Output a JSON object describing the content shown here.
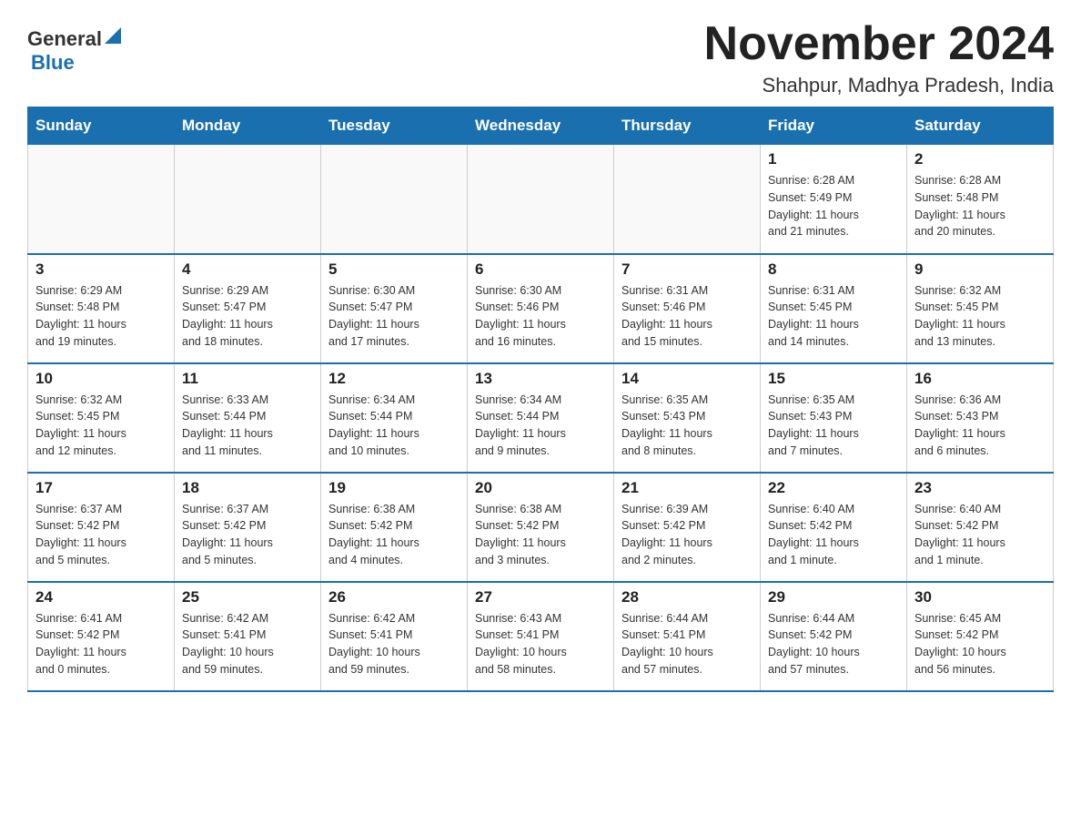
{
  "header": {
    "logo_general": "General",
    "logo_blue": "Blue",
    "month_title": "November 2024",
    "location": "Shahpur, Madhya Pradesh, India"
  },
  "days_of_week": [
    "Sunday",
    "Monday",
    "Tuesday",
    "Wednesday",
    "Thursday",
    "Friday",
    "Saturday"
  ],
  "weeks": [
    [
      {
        "day": "",
        "info": ""
      },
      {
        "day": "",
        "info": ""
      },
      {
        "day": "",
        "info": ""
      },
      {
        "day": "",
        "info": ""
      },
      {
        "day": "",
        "info": ""
      },
      {
        "day": "1",
        "info": "Sunrise: 6:28 AM\nSunset: 5:49 PM\nDaylight: 11 hours\nand 21 minutes."
      },
      {
        "day": "2",
        "info": "Sunrise: 6:28 AM\nSunset: 5:48 PM\nDaylight: 11 hours\nand 20 minutes."
      }
    ],
    [
      {
        "day": "3",
        "info": "Sunrise: 6:29 AM\nSunset: 5:48 PM\nDaylight: 11 hours\nand 19 minutes."
      },
      {
        "day": "4",
        "info": "Sunrise: 6:29 AM\nSunset: 5:47 PM\nDaylight: 11 hours\nand 18 minutes."
      },
      {
        "day": "5",
        "info": "Sunrise: 6:30 AM\nSunset: 5:47 PM\nDaylight: 11 hours\nand 17 minutes."
      },
      {
        "day": "6",
        "info": "Sunrise: 6:30 AM\nSunset: 5:46 PM\nDaylight: 11 hours\nand 16 minutes."
      },
      {
        "day": "7",
        "info": "Sunrise: 6:31 AM\nSunset: 5:46 PM\nDaylight: 11 hours\nand 15 minutes."
      },
      {
        "day": "8",
        "info": "Sunrise: 6:31 AM\nSunset: 5:45 PM\nDaylight: 11 hours\nand 14 minutes."
      },
      {
        "day": "9",
        "info": "Sunrise: 6:32 AM\nSunset: 5:45 PM\nDaylight: 11 hours\nand 13 minutes."
      }
    ],
    [
      {
        "day": "10",
        "info": "Sunrise: 6:32 AM\nSunset: 5:45 PM\nDaylight: 11 hours\nand 12 minutes."
      },
      {
        "day": "11",
        "info": "Sunrise: 6:33 AM\nSunset: 5:44 PM\nDaylight: 11 hours\nand 11 minutes."
      },
      {
        "day": "12",
        "info": "Sunrise: 6:34 AM\nSunset: 5:44 PM\nDaylight: 11 hours\nand 10 minutes."
      },
      {
        "day": "13",
        "info": "Sunrise: 6:34 AM\nSunset: 5:44 PM\nDaylight: 11 hours\nand 9 minutes."
      },
      {
        "day": "14",
        "info": "Sunrise: 6:35 AM\nSunset: 5:43 PM\nDaylight: 11 hours\nand 8 minutes."
      },
      {
        "day": "15",
        "info": "Sunrise: 6:35 AM\nSunset: 5:43 PM\nDaylight: 11 hours\nand 7 minutes."
      },
      {
        "day": "16",
        "info": "Sunrise: 6:36 AM\nSunset: 5:43 PM\nDaylight: 11 hours\nand 6 minutes."
      }
    ],
    [
      {
        "day": "17",
        "info": "Sunrise: 6:37 AM\nSunset: 5:42 PM\nDaylight: 11 hours\nand 5 minutes."
      },
      {
        "day": "18",
        "info": "Sunrise: 6:37 AM\nSunset: 5:42 PM\nDaylight: 11 hours\nand 5 minutes."
      },
      {
        "day": "19",
        "info": "Sunrise: 6:38 AM\nSunset: 5:42 PM\nDaylight: 11 hours\nand 4 minutes."
      },
      {
        "day": "20",
        "info": "Sunrise: 6:38 AM\nSunset: 5:42 PM\nDaylight: 11 hours\nand 3 minutes."
      },
      {
        "day": "21",
        "info": "Sunrise: 6:39 AM\nSunset: 5:42 PM\nDaylight: 11 hours\nand 2 minutes."
      },
      {
        "day": "22",
        "info": "Sunrise: 6:40 AM\nSunset: 5:42 PM\nDaylight: 11 hours\nand 1 minute."
      },
      {
        "day": "23",
        "info": "Sunrise: 6:40 AM\nSunset: 5:42 PM\nDaylight: 11 hours\nand 1 minute."
      }
    ],
    [
      {
        "day": "24",
        "info": "Sunrise: 6:41 AM\nSunset: 5:42 PM\nDaylight: 11 hours\nand 0 minutes."
      },
      {
        "day": "25",
        "info": "Sunrise: 6:42 AM\nSunset: 5:41 PM\nDaylight: 10 hours\nand 59 minutes."
      },
      {
        "day": "26",
        "info": "Sunrise: 6:42 AM\nSunset: 5:41 PM\nDaylight: 10 hours\nand 59 minutes."
      },
      {
        "day": "27",
        "info": "Sunrise: 6:43 AM\nSunset: 5:41 PM\nDaylight: 10 hours\nand 58 minutes."
      },
      {
        "day": "28",
        "info": "Sunrise: 6:44 AM\nSunset: 5:41 PM\nDaylight: 10 hours\nand 57 minutes."
      },
      {
        "day": "29",
        "info": "Sunrise: 6:44 AM\nSunset: 5:42 PM\nDaylight: 10 hours\nand 57 minutes."
      },
      {
        "day": "30",
        "info": "Sunrise: 6:45 AM\nSunset: 5:42 PM\nDaylight: 10 hours\nand 56 minutes."
      }
    ]
  ]
}
